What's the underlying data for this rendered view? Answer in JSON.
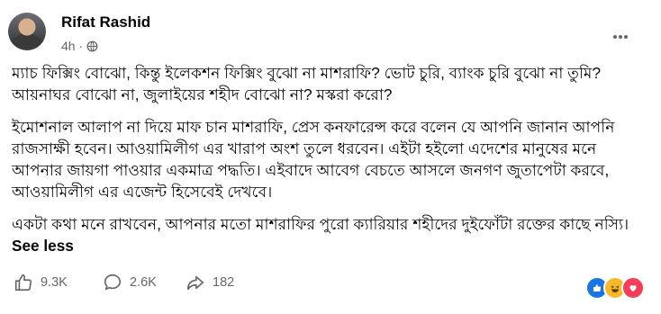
{
  "post": {
    "author": "Rifat Rashid",
    "time": "4h ·",
    "paragraphs": [
      "ম্যাচ ফিক্সিং বোঝো, কিন্তু ইলেকশন ফিক্সিং বুঝো না মাশরাফি? ভোট চুরি, ব্যাংক চুরি বুঝো না তুমি? আয়নাঘর বোঝো না, জুলাইয়ের শহীদ বোঝো না? মস্করা করো?",
      "ইমোশনাল আলাপ না দিয়ে মাফ চান মাশরাফি, প্রেস কনফারেন্স করে বলেন যে আপনি জানান আপনি রাজসাক্ষী হবেন। আওয়ামিলীগ এর খারাপ অংশ তুলে ধরবেন। এইটা হইলো এদেশের মানুষের মনে আপনার জায়গা পাওয়ার একমাত্র পদ্ধতি। এইবাদে আবেগ বেচতে আসলে জনগণ জুতাপেটা করবে, আওয়ামিলীগ এর এজেন্ট হিসেবেই দেখবে।",
      "একটা কথা মনে রাখবেন, আপনার মতো মাশরাফির পুরো ক্যারিয়ার শহীদের দুইফোঁটা রক্তের কাছে নস্যি।"
    ],
    "see_less": "See less"
  },
  "stats": {
    "likes": "9.3K",
    "comments": "2.6K",
    "shares": "182"
  },
  "icons": {
    "privacy": "globe-icon",
    "more": "more-options-icon",
    "like": "thumbs-up-icon",
    "comment": "comment-icon",
    "share": "share-icon",
    "reactions": [
      "like-reaction-icon",
      "haha-reaction-icon",
      "love-reaction-icon"
    ]
  },
  "colors": {
    "secondary_text": "#65676b",
    "like": "#1b74e4",
    "haha": "#f7b928",
    "love": "#f33e58"
  }
}
